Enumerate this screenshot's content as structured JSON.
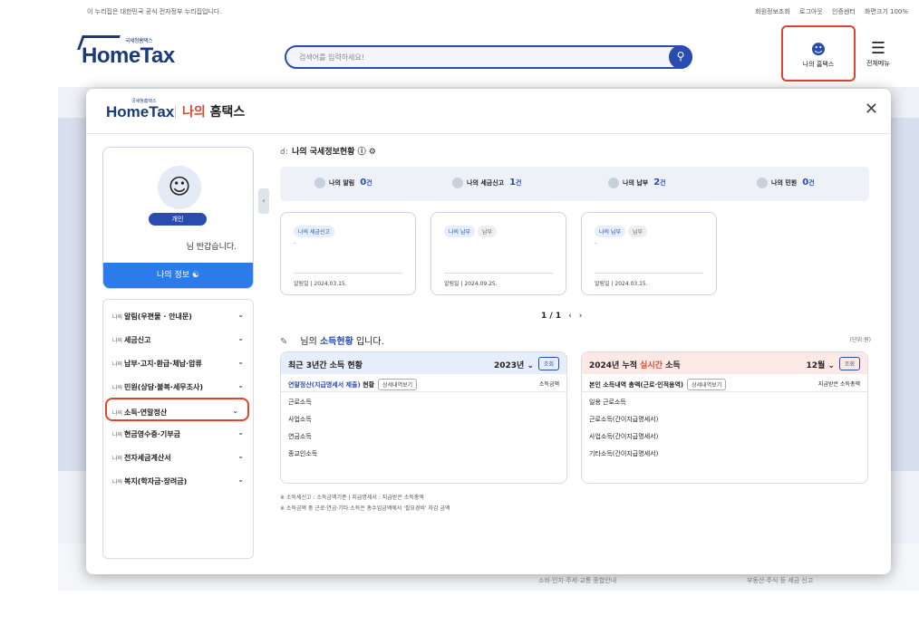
{
  "topbar": {
    "notice": "이 누리집은 대한민국 공식 전자정부 누리집입니다.",
    "links": [
      "회원정보조회",
      "로그아웃",
      "인증센터",
      "화면크기 100%"
    ]
  },
  "header": {
    "logo_small": "국세청홈택스",
    "logo_text": "HomeTax",
    "search_placeholder": "검색어를 입력하세요!",
    "my_hometax": "나의 홈택스",
    "menu": "전체메뉴"
  },
  "modal": {
    "logo_small": "국세청홈택스",
    "logo_text": "HomeTax",
    "title_red": "나의",
    "title_rest": "홈택스",
    "profile": {
      "badge": "개인",
      "greeting": "님 반갑습니다.",
      "my_info": "나의 정보"
    },
    "menu_items": [
      {
        "pre": "나의",
        "label": "알림(우편물 · 안내문)"
      },
      {
        "pre": "나의",
        "label": "세금신고"
      },
      {
        "pre": "나의",
        "label": "납부·고지·환급·체납·압류"
      },
      {
        "pre": "나의",
        "label": "민원(상담·불복·세무조사)"
      },
      {
        "pre": "나의",
        "label": "소득·연말정산"
      },
      {
        "pre": "나의",
        "label": "현금영수증·기부금"
      },
      {
        "pre": "나의",
        "label": "전자세금계산서"
      },
      {
        "pre": "나의",
        "label": "복지(학자금·장려금)"
      }
    ],
    "status_title": "나의 국세정보현황",
    "summary": [
      {
        "label": "나의 알림",
        "count": "0",
        "unit": "건"
      },
      {
        "label": "나의 세금신고",
        "count": "1",
        "unit": "건"
      },
      {
        "label": "나의 납부",
        "count": "2",
        "unit": "건"
      },
      {
        "label": "나의 민원",
        "count": "0",
        "unit": "건"
      }
    ],
    "cards": [
      {
        "tag1": "나의 세금신고",
        "tag2": "",
        "dash": "-",
        "date": "알림일 | 2024.03.15."
      },
      {
        "tag1": "나의 납부",
        "tag2": "납부",
        "dash": "",
        "date": "알림일 | 2024.09.25."
      },
      {
        "tag1": "나의 납부",
        "tag2": "납부",
        "dash": "-",
        "date": "알림일 | 2024.03.15."
      }
    ],
    "pager": "1 / 1",
    "income_title_pre": "님의",
    "income_title_hl": "소득현황",
    "income_title_post": "입니다.",
    "unit": "(단위:원)",
    "left_panel": {
      "title": "최근 3년간 소득 현황",
      "year": "2023년",
      "btn": "조회",
      "sub_link": "연말정산(지급명세서 제출)",
      "sub_text": "현황",
      "sub_tag": "상세내역보기",
      "sub_right": "소득금액",
      "rows": [
        "근로소득",
        "사업소득",
        "연금소득",
        "종교인소득"
      ]
    },
    "right_panel": {
      "title_pre": "2024년 누적",
      "title_red": "실시간",
      "title_post": "소득",
      "month": "12월",
      "btn": "조회",
      "sub": "본인 소득내역 총액(근로·인적용역)",
      "sub_tag": "상세내역보기",
      "sub_right": "지급받은 소득총액",
      "rows": [
        "일용 근로소득",
        "근로소득(간이지급명세서)",
        "사업소득(간이지급명세서)",
        "기타소득(간이지급명세서)"
      ]
    },
    "notes": [
      "※ 소득세신고 : 소득금액기준  |  지급명세서 : 지급받은 소득총액",
      "※ 소득금액 중 근로·연금·기타 소득은 총수입금액에서 '필요경비' 차감 금액"
    ]
  },
  "background": {
    "bottom1": "소비·인지·주세·교통 종합안내",
    "bottom2": "부동산·주식 등 세금 신고"
  }
}
